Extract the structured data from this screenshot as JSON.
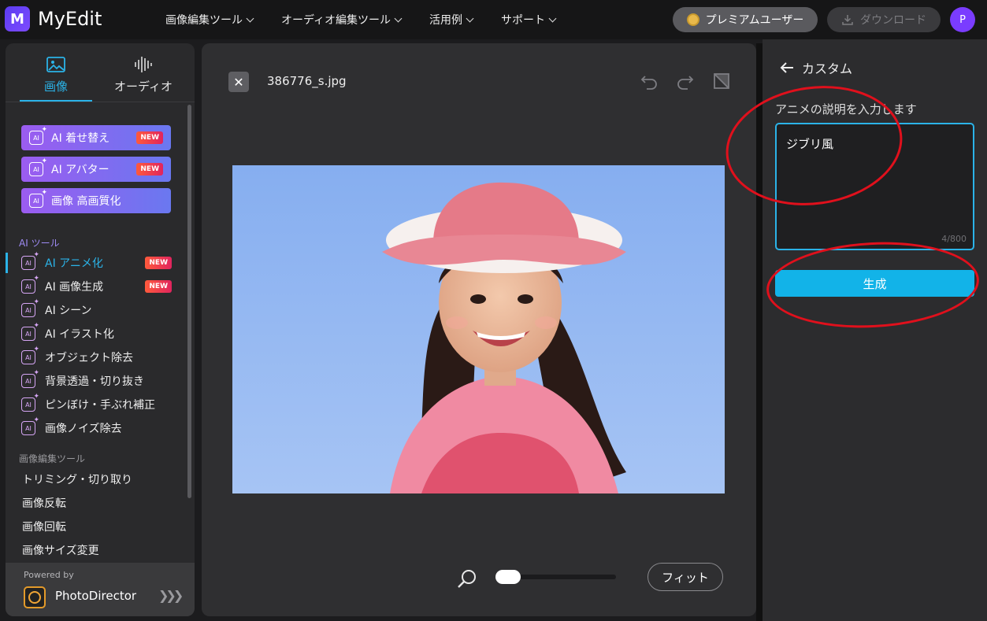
{
  "app": {
    "logo_letter": "M",
    "name": "MyEdit"
  },
  "nav": [
    {
      "label": "画像編集ツール"
    },
    {
      "label": "オーディオ編集ツール"
    },
    {
      "label": "活用例"
    },
    {
      "label": "サポート"
    }
  ],
  "header": {
    "premium_label": "プレミアムユーザー",
    "download_label": "ダウンロード",
    "avatar_initial": "P"
  },
  "sidebar": {
    "tabs": [
      {
        "label": "画像"
      },
      {
        "label": "オーディオ"
      }
    ],
    "promos": [
      {
        "label": "AI 着せ替え",
        "badge": "NEW"
      },
      {
        "label": "AI アバター",
        "badge": "NEW"
      },
      {
        "label": "画像 高画質化"
      }
    ],
    "ai_section_label": "AI ツール",
    "ai_tools": [
      {
        "label": "AI アニメ化",
        "badge": "NEW",
        "active": true
      },
      {
        "label": "AI 画像生成",
        "badge": "NEW"
      },
      {
        "label": "AI シーン"
      },
      {
        "label": "AI イラスト化"
      },
      {
        "label": "オブジェクト除去"
      },
      {
        "label": "背景透過・切り抜き"
      },
      {
        "label": "ピンぼけ・手ぶれ補正"
      },
      {
        "label": "画像ノイズ除去"
      }
    ],
    "edit_section_label": "画像編集ツール",
    "edit_tools": [
      {
        "label": "トリミング・切り取り"
      },
      {
        "label": "画像反転"
      },
      {
        "label": "画像回転"
      },
      {
        "label": "画像サイズ変更"
      }
    ],
    "powered_by": "Powered by",
    "powered_name": "PhotoDirector"
  },
  "canvas": {
    "filename": "386776_s.jpg",
    "fit_label": "フィット",
    "zoom_level": 0
  },
  "panel": {
    "back_label": "カスタム",
    "description_label": "アニメの説明を入力します",
    "description_value": "ジブリ風",
    "char_counter": "4/800",
    "generate_label": "生成"
  },
  "colors": {
    "accent": "#2bb3e8",
    "annotation": "#e0101c",
    "brand": "#6a3cf5"
  }
}
